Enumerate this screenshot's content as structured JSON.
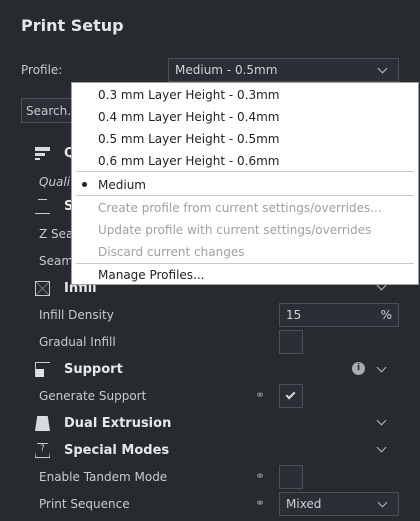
{
  "title": "Print Setup",
  "profile": {
    "label": "Profile:",
    "value": "Medium - 0.5mm"
  },
  "search": {
    "placeholder": "Search..."
  },
  "obscured": {
    "quality_head": "Q",
    "quality_sub": "Quali",
    "shell_head": "S",
    "z_seam": "Z Sea",
    "seam": "Seam"
  },
  "menu": {
    "items": [
      "0.3 mm Layer Height - 0.3mm",
      "0.4 mm Layer Height - 0.4mm",
      "0.5 mm Layer Height - 0.5mm",
      "0.6 mm Layer Height - 0.6mm"
    ],
    "selected": "Medium",
    "create": "Create profile from current settings/overrides...",
    "update": "Update profile with current settings/overrides",
    "discard": "Discard current changes",
    "manage": "Manage Profiles..."
  },
  "sections": {
    "infill": {
      "title": "Infill",
      "density_label": "Infill Density",
      "density_value": "15",
      "density_unit": "%",
      "gradual_label": "Gradual Infill"
    },
    "support": {
      "title": "Support",
      "generate_label": "Generate Support",
      "generate_checked": true
    },
    "dual": {
      "title": "Dual Extrusion"
    },
    "special": {
      "title": "Special Modes",
      "tandem_label": "Enable Tandem Mode",
      "sequence_label": "Print Sequence",
      "sequence_value": "Mixed"
    }
  }
}
